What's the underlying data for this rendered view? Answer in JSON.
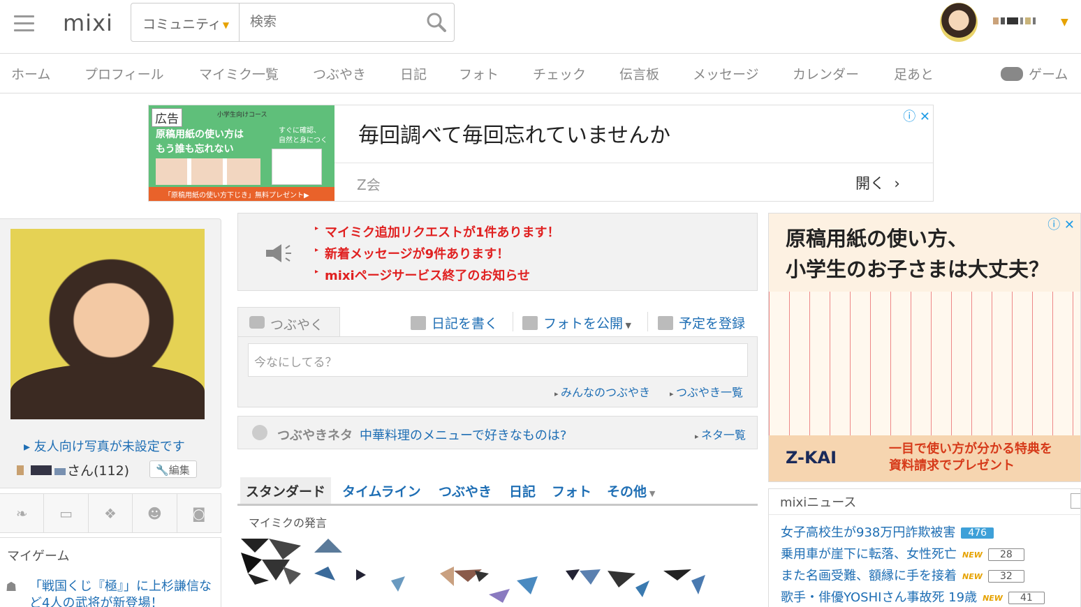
{
  "header": {
    "logo": "mixi",
    "search_scope": "コミュニティ",
    "search_placeholder": "検索"
  },
  "nav": {
    "items": [
      "ホーム",
      "プロフィール",
      "マイミク一覧",
      "つぶやき",
      "日記",
      "フォト",
      "チェック",
      "伝言板",
      "メッセージ",
      "カレンダー",
      "足あと"
    ],
    "game": "ゲーム"
  },
  "top_ad": {
    "tag": "広告",
    "small": "小学生向けコース",
    "image_line1": "原稿用紙の使い方は",
    "image_line2": "もう誰も忘れない",
    "image_side1": "すぐに確認、",
    "image_side2": "自然と身につく",
    "image_band": "「原稿用紙の使い方下じき」無料プレゼント▶",
    "headline": "毎回調べて毎回忘れていませんか",
    "sponsor": "Z会",
    "open": "開く"
  },
  "profile": {
    "photo_note": "友人向け写真が未設定です",
    "name_suffix": "さん(112)",
    "edit": "編集"
  },
  "mygame": {
    "title": "マイゲーム",
    "text": "「戦国くじ『極』」に上杉謙信など4人の武将が新登場！"
  },
  "notices": [
    "マイミク追加リクエストが1件あります！",
    "新着メッセージが9件あります！",
    "mixiページサービス終了のお知らせ"
  ],
  "compose": {
    "tab": "つぶやく",
    "diary": "日記を書く",
    "photo": "フォトを公開",
    "schedule": "予定を登録",
    "placeholder": "今なにしてる？",
    "everyone": "みんなのつぶやき",
    "list": "つぶやき一覧"
  },
  "neta": {
    "label": "つぶやきネタ",
    "topic": "中華料理のメニューで好きなものは?",
    "list": "ネタ一覧"
  },
  "feed_tabs": [
    "スタンダード",
    "タイムライン",
    "つぶやき",
    "日記",
    "フォト",
    "その他"
  ],
  "feed_label": "マイミクの発言",
  "right_ad": {
    "title1": "原稿用紙の使い方、",
    "title2": "小学生のお子さまは大丈夫？",
    "logo": "Z-KAI",
    "cta1": "一目で使い方が分かる特典を",
    "cta2": "資料請求でプレゼント"
  },
  "news": {
    "title": "mixiニュース",
    "items": [
      {
        "text": "女子高校生が938万円詐欺被害",
        "badge": "476"
      },
      {
        "text": "乗用車が崖下に転落、女性死亡",
        "new": "NEW",
        "count": "28"
      },
      {
        "text": "また名画受難、額縁に手を接着",
        "new": "NEW",
        "count": "32"
      },
      {
        "text": "歌手・俳優YOSHIさん事故死 19歳",
        "new": "NEW",
        "count": "41"
      }
    ]
  },
  "colors": {
    "link": "#1e6eb4",
    "alert": "#e02020",
    "accent": "#e6a200"
  }
}
